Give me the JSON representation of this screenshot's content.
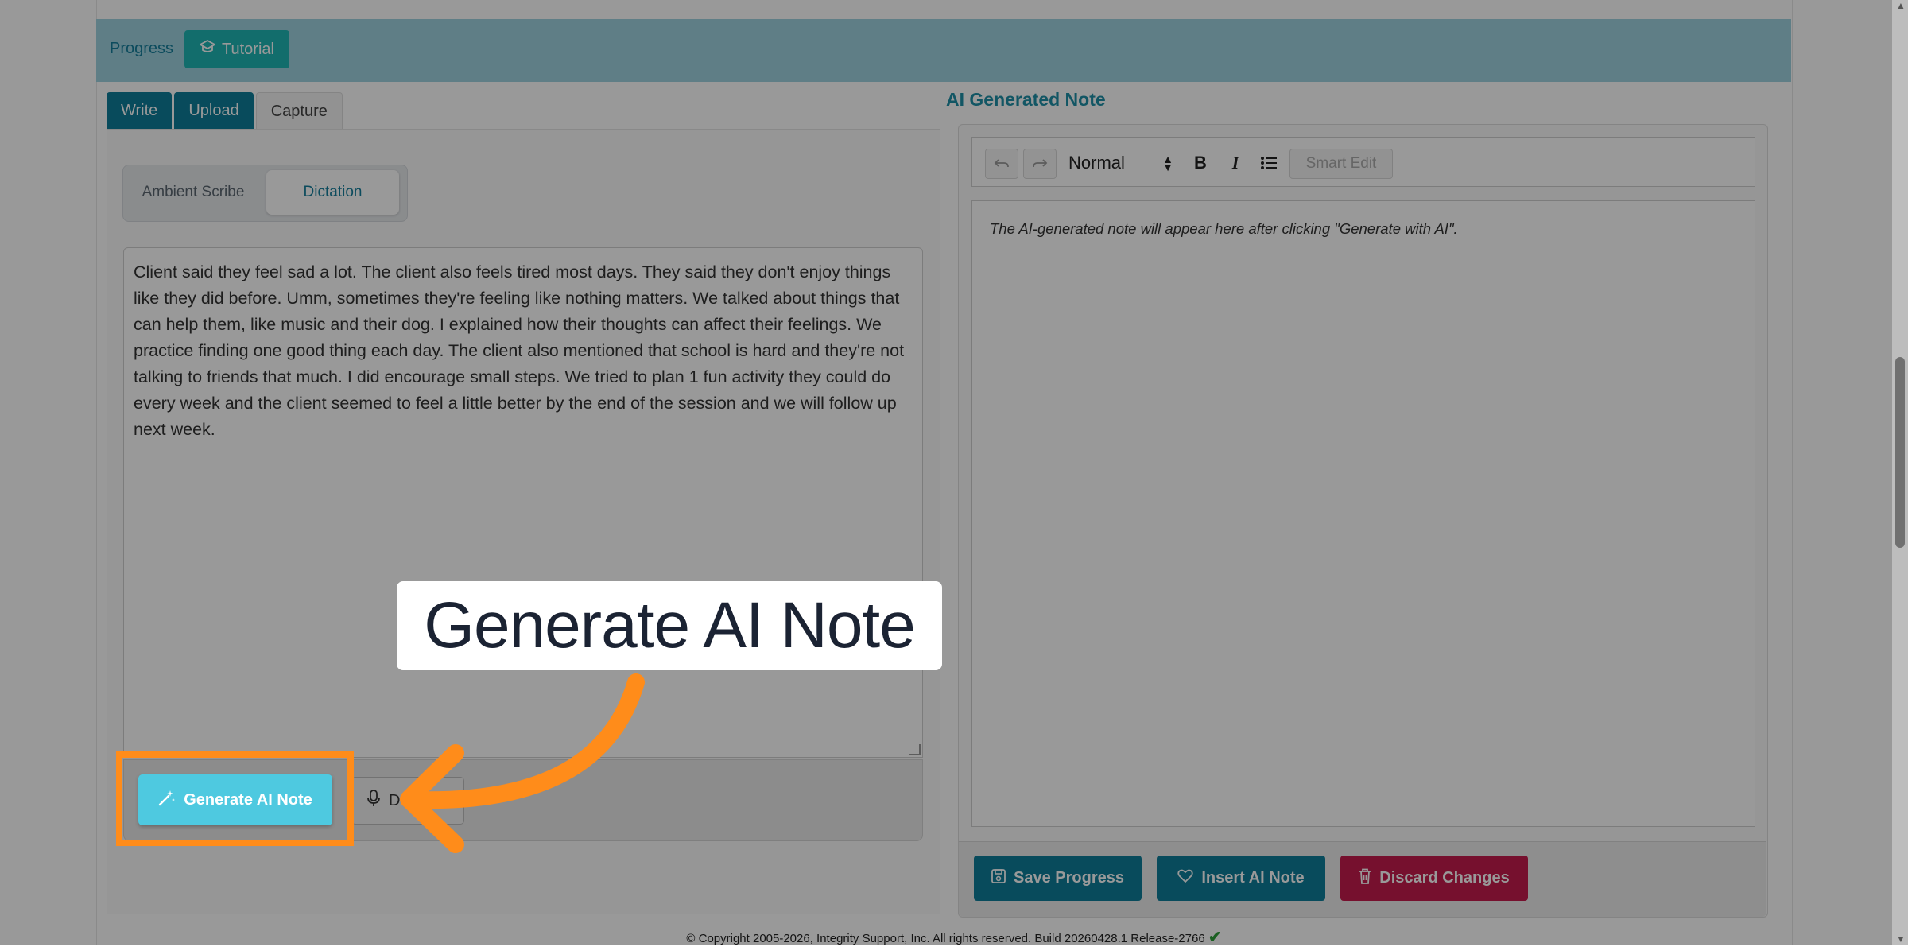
{
  "header": {
    "progress_link": "Progress",
    "tutorial_button": "Tutorial"
  },
  "tabs": [
    {
      "label": "Write",
      "active": true
    },
    {
      "label": "Upload",
      "active": true
    },
    {
      "label": "Capture",
      "active": false
    }
  ],
  "capture_mode": {
    "options": [
      "Ambient Scribe",
      "Dictation"
    ],
    "selected": "Dictation"
  },
  "transcript": "Client said they feel sad a lot. The client also feels tired most days. They said they don't enjoy things like they did before. Umm, sometimes they're feeling like nothing matters. We talked about things that can help them, like music and their dog. I explained how their thoughts can affect their feelings. We practice finding one good thing each day. The client also mentioned that school is hard and they're not talking to friends that much. I did encourage small steps. We tried to plan 1 fun activity they could do every week and the client seemed to feel a little better by the end of the session and we will follow up next week.",
  "left_actions": {
    "generate": "Generate AI Note",
    "dictate_partial": "D"
  },
  "ai_note": {
    "title": "AI Generated Note",
    "format_select": "Normal",
    "smart_edit": "Smart Edit",
    "placeholder": "The AI-generated note will appear here after clicking \"Generate with AI\"."
  },
  "right_actions": {
    "save": "Save Progress",
    "insert": "Insert AI Note",
    "discard": "Discard Changes"
  },
  "footer": {
    "copyright": "© Copyright 2005-2026, Integrity Support, Inc. All rights reserved. Build 20260428.1 Release-2766"
  },
  "tutorial_callout": {
    "text": "Generate AI Note"
  },
  "colors": {
    "teal": "#0e7e99",
    "accent": "#1fb6b4",
    "danger": "#c51c4d",
    "highlight": "#ff8c1a"
  },
  "icons": {
    "tutorial": "graduation-cap-icon",
    "generate": "magic-wand-icon",
    "dictate": "microphone-icon",
    "save": "floppy-disk-icon",
    "insert": "heart-icon",
    "discard": "trash-icon"
  }
}
